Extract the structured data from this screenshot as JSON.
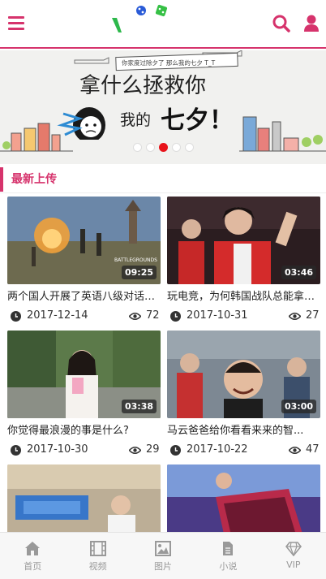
{
  "header": {
    "menu_icon": "menu-icon",
    "search_icon": "search-icon",
    "user_icon": "user-icon",
    "accent_color": "#d6336c"
  },
  "banner": {
    "top_note": "你家度过除夕了 那么我的七夕 T_T",
    "headline_1": "拿什么拯救你",
    "headline_2": "我的",
    "headline_3": "七夕！",
    "slide_count": 5,
    "active_slide": 3
  },
  "section": {
    "title": "最新上传"
  },
  "videos": [
    {
      "title": "两个国人开展了英语八级对话，...",
      "duration": "09:25",
      "date": "2017-12-14",
      "views": "72",
      "watermark": "BATTLEGROUNDS"
    },
    {
      "title": "玩电竞，为何韩国战队总能拿冠军？",
      "duration": "03:46",
      "date": "2017-10-31",
      "views": "27"
    },
    {
      "title": "你觉得最浪漫的事是什么?",
      "duration": "03:38",
      "date": "2017-10-30",
      "views": "29"
    },
    {
      "title": "马云爸爸给你看看来来的智...",
      "duration": "03:00",
      "date": "2017-10-22",
      "views": "47"
    },
    {
      "title": "",
      "duration": "",
      "date": "",
      "views": ""
    },
    {
      "title": "",
      "duration": "",
      "date": "",
      "views": ""
    }
  ],
  "footer": {
    "items": [
      {
        "label": "首页",
        "icon": "home-icon"
      },
      {
        "label": "视频",
        "icon": "film-icon"
      },
      {
        "label": "图片",
        "icon": "image-icon"
      },
      {
        "label": "小说",
        "icon": "document-icon"
      },
      {
        "label": "VIP",
        "icon": "diamond-icon"
      }
    ]
  }
}
